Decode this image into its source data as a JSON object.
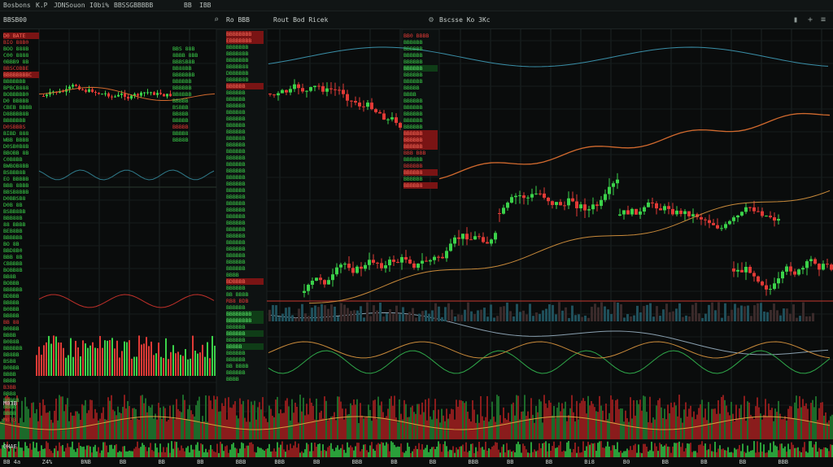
{
  "topbar": {
    "brand": "Bosbons",
    "t1": "K.P",
    "t2": "JDNSouon",
    "t3": "I0bi%",
    "t4": "BBSSGBBBBB",
    "t5": "BB",
    "t6": "IBB"
  },
  "toolbar": {
    "left_label": "BBSB00",
    "pane1_title": "Ro BBB",
    "pane2_title": "Rout Bod Ricek",
    "pane3_title": "Bscsse Ko 3Kc",
    "icon_search": "search-icon",
    "icon_settings": "settings-icon",
    "icon_add": "add-icon"
  },
  "left_quotes": [
    {
      "t": "D0 BATE",
      "c": "bg-dn"
    },
    {
      "t": "BIO 88B0",
      "c": "dn"
    },
    {
      "t": "BOO 888B",
      "c": "up"
    },
    {
      "t": "C00 8888",
      "c": "up"
    },
    {
      "t": "0BBB9 8B",
      "c": "up"
    },
    {
      "t": "BBSCOBBE",
      "c": "dn"
    },
    {
      "t": "BBBBBBBBC",
      "c": "bg-dn"
    },
    {
      "t": "BBBBBBB",
      "c": "up"
    },
    {
      "t": "BPBCB888",
      "c": "up"
    },
    {
      "t": "BOBBBBB0",
      "c": "up"
    },
    {
      "t": "D0 BBBBB",
      "c": "up"
    },
    {
      "t": "CBEB BBBB",
      "c": "up"
    },
    {
      "t": "D8BBBB8B",
      "c": "up"
    },
    {
      "t": "BBBBBBB",
      "c": "up"
    },
    {
      "t": "D0SBBBS",
      "c": "dn"
    },
    {
      "t": "BIBD 888",
      "c": "up"
    },
    {
      "t": "WBB BBBB",
      "c": "up"
    },
    {
      "t": "D0SB0B8B",
      "c": "up"
    },
    {
      "t": "BBOBB 8B",
      "c": "up"
    },
    {
      "t": "C0B8BB",
      "c": "up"
    },
    {
      "t": "BWBOB8BB",
      "c": "up"
    },
    {
      "t": "BSBBB8B",
      "c": "up"
    },
    {
      "t": "EO BBBBB",
      "c": "up"
    },
    {
      "t": "BBB 8BBB",
      "c": "up"
    },
    {
      "t": "BBSB8BBB",
      "c": "up"
    },
    {
      "t": "D0BBSB8",
      "c": "up"
    },
    {
      "t": "D0B 8B",
      "c": "up"
    },
    {
      "t": "BSBB8BB",
      "c": "up"
    },
    {
      "t": "BBB88B",
      "c": "up"
    },
    {
      "t": "88 BBBB",
      "c": "up"
    },
    {
      "t": "BEB8BB",
      "c": "up"
    },
    {
      "t": "BBBBBB",
      "c": "up"
    },
    {
      "t": "BO 8B",
      "c": "up"
    },
    {
      "t": "BBD8B0",
      "c": "up"
    },
    {
      "t": "BBB 8B",
      "c": "up"
    },
    {
      "t": "CBBBBB",
      "c": "up"
    },
    {
      "t": "BOBB8B",
      "c": "up"
    },
    {
      "t": "BB8B",
      "c": "up"
    },
    {
      "t": "BOBBB",
      "c": "up"
    },
    {
      "t": "BBBBBB",
      "c": "up"
    },
    {
      "t": "BDBBB",
      "c": "up"
    },
    {
      "t": "BBBBB",
      "c": "up"
    },
    {
      "t": "B0BBB",
      "c": "up"
    },
    {
      "t": "BBBBB",
      "c": "up"
    },
    {
      "t": "BB 88",
      "c": "dn"
    },
    {
      "t": "B0BBB",
      "c": "up"
    },
    {
      "t": "BBBB",
      "c": "up"
    },
    {
      "t": "B0B8B",
      "c": "up"
    },
    {
      "t": "BBBBBB",
      "c": "up"
    },
    {
      "t": "BB8BB",
      "c": "up"
    },
    {
      "t": "BSB8",
      "c": "up"
    },
    {
      "t": "B0BBB",
      "c": "up"
    },
    {
      "t": "BBBB",
      "c": "up"
    },
    {
      "t": "BBBB",
      "c": "up"
    },
    {
      "t": "B3BB",
      "c": "dn"
    },
    {
      "t": "BBB8",
      "c": "up"
    },
    {
      "t": "B0BBB",
      "c": "up"
    },
    {
      "t": "BBBB",
      "c": "up"
    },
    {
      "t": "BBB8",
      "c": "up"
    },
    {
      "t": "M03B",
      "c": "dn"
    }
  ],
  "mid_quotes_a": [
    {
      "t": "BBS 88B",
      "c": "up"
    },
    {
      "t": "8BBB 8BB",
      "c": "up"
    },
    {
      "t": "BBBSB8B",
      "c": "up"
    },
    {
      "t": "BB88BB",
      "c": "up"
    },
    {
      "t": "BBBBBBB",
      "c": "up"
    },
    {
      "t": "BBBBBB",
      "c": "up"
    },
    {
      "t": "BBBBBB",
      "c": "up"
    },
    {
      "t": "BB8BBB",
      "c": "up"
    },
    {
      "t": "BBBBB",
      "c": "up"
    },
    {
      "t": "BSBBB",
      "c": "up"
    },
    {
      "t": "BB8BB",
      "c": "up"
    },
    {
      "t": "BBBBB",
      "c": "up"
    },
    {
      "t": "BBBBB",
      "c": "dn"
    },
    {
      "t": "BBBB8",
      "c": "up"
    },
    {
      "t": "BBB8B",
      "c": "up"
    }
  ],
  "mid_quotes_b": [
    {
      "t": "BBBBBBBB",
      "c": "bg-dn"
    },
    {
      "t": "EBBBBBBB",
      "c": "bg-dn"
    },
    {
      "t": "BBBBBBB",
      "c": "up"
    },
    {
      "t": "BBBB8BB",
      "c": "up"
    },
    {
      "t": "BBBBBBB",
      "c": "up"
    },
    {
      "t": "BBBBB88",
      "c": "up"
    },
    {
      "t": "DBBBBBB",
      "c": "up"
    },
    {
      "t": "BBBBB8B",
      "c": "up"
    },
    {
      "t": "BBBBBB",
      "c": "bg-dn"
    },
    {
      "t": "BBBBBB",
      "c": "up"
    },
    {
      "t": "BBBBBB",
      "c": "up"
    },
    {
      "t": "BBBBBB",
      "c": "up"
    },
    {
      "t": "BBBB8B",
      "c": "up"
    },
    {
      "t": "BBBBBB",
      "c": "up"
    },
    {
      "t": "BBBBBB",
      "c": "up"
    },
    {
      "t": "BBBBBB",
      "c": "up"
    },
    {
      "t": "BBBB8B",
      "c": "up"
    },
    {
      "t": "BBBBBB",
      "c": "up"
    },
    {
      "t": "BBBBBB",
      "c": "up"
    },
    {
      "t": "BBBBBB",
      "c": "up"
    },
    {
      "t": "BBBBBB",
      "c": "up"
    },
    {
      "t": "BBBBBB",
      "c": "up"
    },
    {
      "t": "BBBBBB",
      "c": "up"
    },
    {
      "t": "BBBBBB",
      "c": "up"
    },
    {
      "t": "BBBBBB",
      "c": "up"
    },
    {
      "t": "BBBB8B",
      "c": "up"
    },
    {
      "t": "BBBBBB",
      "c": "up"
    },
    {
      "t": "BBBBBB",
      "c": "up"
    },
    {
      "t": "BBBBBB",
      "c": "up"
    },
    {
      "t": "BBBBBB",
      "c": "up"
    },
    {
      "t": "BBBBBB",
      "c": "up"
    },
    {
      "t": "BBBBBB",
      "c": "up"
    },
    {
      "t": "BBBBBB",
      "c": "up"
    },
    {
      "t": "BBBBBB",
      "c": "up"
    },
    {
      "t": "BBBBBB",
      "c": "up"
    },
    {
      "t": "BBBBBB",
      "c": "up"
    },
    {
      "t": "BBBBBB",
      "c": "up"
    },
    {
      "t": "BBBB",
      "c": "up"
    },
    {
      "t": "BDBBBB",
      "c": "bg-dn"
    },
    {
      "t": "BBBBBB",
      "c": "up"
    },
    {
      "t": "BB BBBB",
      "c": "up"
    },
    {
      "t": "RB8 BDB",
      "c": "dn"
    },
    {
      "t": "BBBBBB",
      "c": "up"
    },
    {
      "t": "BBBBBBBB",
      "c": "bg-up"
    },
    {
      "t": "BBBBBBBB",
      "c": "bg-up"
    },
    {
      "t": "BBBBBB",
      "c": "up"
    },
    {
      "t": "BBBBBB",
      "c": "bg-up"
    },
    {
      "t": "BBBBBB",
      "c": "up"
    },
    {
      "t": "BBBBB",
      "c": "bg-up"
    },
    {
      "t": "BBBBBB",
      "c": "up"
    },
    {
      "t": "BBBBBB",
      "c": "up"
    },
    {
      "t": "BB BBBB",
      "c": "up"
    },
    {
      "t": "BBBBBB",
      "c": "up"
    },
    {
      "t": "BBBB",
      "c": "up"
    }
  ],
  "chart_quotes": [
    {
      "t": "BB0 BBBB",
      "c": "dn"
    },
    {
      "t": "BBB8BB",
      "c": "up"
    },
    {
      "t": "BBBBBB",
      "c": "up"
    },
    {
      "t": "BBBBBB",
      "c": "up"
    },
    {
      "t": "BBBBBB",
      "c": "up"
    },
    {
      "t": "BBBBBB",
      "c": "bg-up"
    },
    {
      "t": "BBBBBB",
      "c": "up"
    },
    {
      "t": "BBBBBB",
      "c": "up"
    },
    {
      "t": "BBBBB",
      "c": "up"
    },
    {
      "t": "BBBB",
      "c": "up"
    },
    {
      "t": "BBBBBB",
      "c": "up"
    },
    {
      "t": "BBBBBB",
      "c": "up"
    },
    {
      "t": "BBBBBB",
      "c": "up"
    },
    {
      "t": "BBBBBB",
      "c": "up"
    },
    {
      "t": "BBBBBB",
      "c": "up"
    },
    {
      "t": "BBBBBB",
      "c": "bg-dn"
    },
    {
      "t": "BBBBBB",
      "c": "bg-dn"
    },
    {
      "t": "BBBBBB",
      "c": "bg-dn"
    },
    {
      "t": "BBB BBB",
      "c": "dn"
    },
    {
      "t": "BBB8BB",
      "c": "up"
    },
    {
      "t": "BBBBBB",
      "c": "dn"
    },
    {
      "t": "BBBBB8",
      "c": "bg-dn"
    },
    {
      "t": "BBBBBB",
      "c": "up"
    },
    {
      "t": "BBBBB8",
      "c": "bg-dn"
    }
  ],
  "bottom_labels": [
    "BB 4a",
    "Z4%",
    "BNB",
    "BB",
    "BB",
    "BB",
    "BBB",
    "BBB",
    "BB",
    "BBB",
    "BB",
    "BB",
    "BBB",
    "BB",
    "BB",
    "Bi8",
    "B0",
    "BB",
    "BB",
    "BB",
    "BBB"
  ],
  "left_footer_label": "0HAE",
  "left_footer_label2": "M03B",
  "colors": {
    "bg": "#0a0c0c",
    "up": "#3bd24a",
    "down": "#e23a36",
    "grid": "#1c2424",
    "accent": "#d26a2e"
  }
}
